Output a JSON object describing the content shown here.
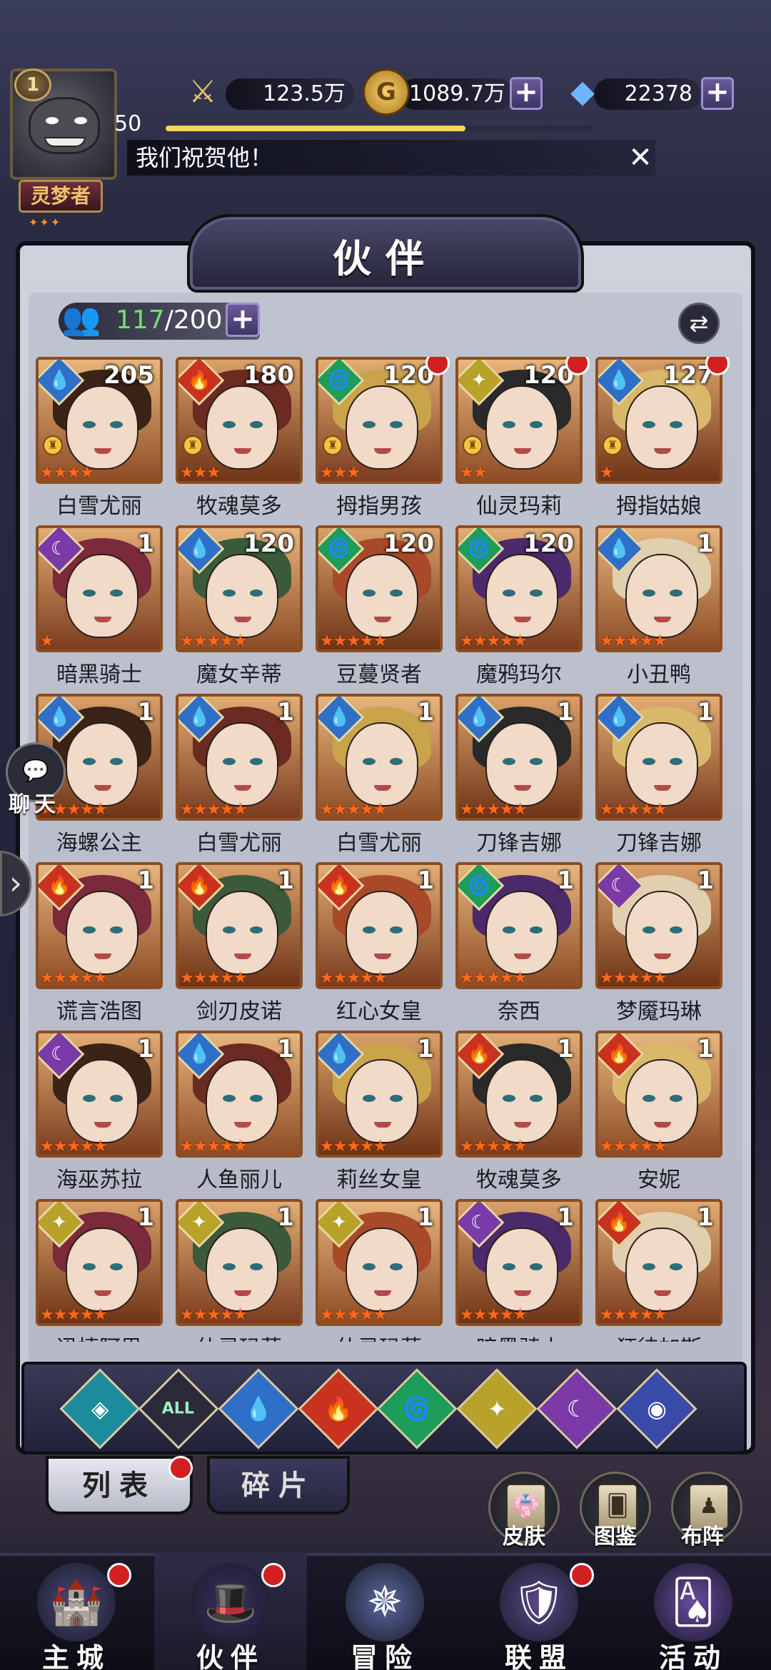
{
  "player": {
    "vip_level": "1",
    "level": "50",
    "title": "灵梦者",
    "xp_fraction": 0.7
  },
  "resources": {
    "power": "123.5万",
    "gold": "1089.7万",
    "diamond": "22378"
  },
  "notice": {
    "text": "我们祝贺他！"
  },
  "panel": {
    "title": "伙伴",
    "count_current": "117",
    "count_max": "/200"
  },
  "heroes": [
    {
      "name": "白雪尤丽",
      "level": "205",
      "element": "water",
      "stars": 4,
      "red_dot": false,
      "rank": true
    },
    {
      "name": "牧魂莫多",
      "level": "180",
      "element": "fire",
      "stars": 3,
      "red_dot": false,
      "rank": true
    },
    {
      "name": "拇指男孩",
      "level": "120",
      "element": "wind",
      "stars": 3,
      "red_dot": true,
      "rank": true
    },
    {
      "name": "仙灵玛莉",
      "level": "120",
      "element": "light",
      "stars": 2,
      "red_dot": true,
      "rank": true
    },
    {
      "name": "拇指姑娘",
      "level": "127",
      "element": "water",
      "stars": 1,
      "red_dot": true,
      "rank": true
    },
    {
      "name": "暗黑骑士",
      "level": "1",
      "element": "dark",
      "stars": 1,
      "red_dot": false,
      "rank": false
    },
    {
      "name": "魔女辛蒂",
      "level": "120",
      "element": "water",
      "stars": 5,
      "red_dot": false,
      "rank": false
    },
    {
      "name": "豆蔓贤者",
      "level": "120",
      "element": "wind",
      "stars": 5,
      "red_dot": false,
      "rank": false
    },
    {
      "name": "魔鸦玛尔",
      "level": "120",
      "element": "wind",
      "stars": 5,
      "red_dot": false,
      "rank": false
    },
    {
      "name": "小丑鸭",
      "level": "1",
      "element": "water",
      "stars": 5,
      "red_dot": false,
      "rank": false
    },
    {
      "name": "海螺公主",
      "level": "1",
      "element": "water",
      "stars": 5,
      "red_dot": false,
      "rank": false
    },
    {
      "name": "白雪尤丽",
      "level": "1",
      "element": "water",
      "stars": 5,
      "red_dot": false,
      "rank": false
    },
    {
      "name": "白雪尤丽",
      "level": "1",
      "element": "water",
      "stars": 5,
      "red_dot": false,
      "rank": false
    },
    {
      "name": "刀锋吉娜",
      "level": "1",
      "element": "water",
      "stars": 5,
      "red_dot": false,
      "rank": false
    },
    {
      "name": "刀锋吉娜",
      "level": "1",
      "element": "water",
      "stars": 5,
      "red_dot": false,
      "rank": false
    },
    {
      "name": "谎言浩图",
      "level": "1",
      "element": "fire",
      "stars": 5,
      "red_dot": false,
      "rank": false
    },
    {
      "name": "剑刃皮诺",
      "level": "1",
      "element": "fire",
      "stars": 5,
      "red_dot": false,
      "rank": false
    },
    {
      "name": "红心女皇",
      "level": "1",
      "element": "fire",
      "stars": 5,
      "red_dot": false,
      "rank": false
    },
    {
      "name": "奈西",
      "level": "1",
      "element": "wind",
      "stars": 5,
      "red_dot": false,
      "rank": false
    },
    {
      "name": "梦魇玛琳",
      "level": "1",
      "element": "dark",
      "stars": 5,
      "red_dot": false,
      "rank": false
    },
    {
      "name": "海巫苏拉",
      "level": "1",
      "element": "dark",
      "stars": 5,
      "red_dot": false,
      "rank": false
    },
    {
      "name": "人鱼丽儿",
      "level": "1",
      "element": "water",
      "stars": 5,
      "red_dot": false,
      "rank": false
    },
    {
      "name": "莉丝女皇",
      "level": "1",
      "element": "water",
      "stars": 5,
      "red_dot": false,
      "rank": false
    },
    {
      "name": "牧魂莫多",
      "level": "1",
      "element": "fire",
      "stars": 5,
      "red_dot": false,
      "rank": false
    },
    {
      "name": "安妮",
      "level": "1",
      "element": "fire",
      "stars": 5,
      "red_dot": false,
      "rank": false
    },
    {
      "name": "迅捷阿思",
      "level": "1",
      "element": "light",
      "stars": 5,
      "red_dot": false,
      "rank": false
    },
    {
      "name": "仙灵玛莉",
      "level": "1",
      "element": "light",
      "stars": 5,
      "red_dot": false,
      "rank": false
    },
    {
      "name": "仙灵玛莉",
      "level": "1",
      "element": "light",
      "stars": 5,
      "red_dot": false,
      "rank": false
    },
    {
      "name": "暗黑骑士",
      "level": "1",
      "element": "dark",
      "stars": 5,
      "red_dot": false,
      "rank": false
    },
    {
      "name": "狂徒加斯",
      "level": "1",
      "element": "fire",
      "stars": 5,
      "red_dot": false,
      "rank": false
    }
  ],
  "filters": [
    "void",
    "ALL",
    "water",
    "fire",
    "wind",
    "light",
    "dark",
    "cosmic"
  ],
  "tabs": {
    "list": "列表",
    "fragments": "碎片"
  },
  "quick_buttons": {
    "skin": "皮肤",
    "codex": "图鉴",
    "formation": "布阵"
  },
  "chat": {
    "label": "聊天"
  },
  "nav": [
    {
      "label": "主城",
      "icon": "castle-icon",
      "red_dot": true,
      "active": false
    },
    {
      "label": "伙伴",
      "icon": "hat-icon",
      "red_dot": true,
      "active": true
    },
    {
      "label": "冒险",
      "icon": "compass-icon",
      "red_dot": false,
      "active": false
    },
    {
      "label": "联盟",
      "icon": "shield-icon",
      "red_dot": true,
      "active": false
    },
    {
      "label": "活动",
      "icon": "cards-icon",
      "red_dot": false,
      "active": false
    }
  ],
  "element_colors": {
    "water": "#2f6fc8",
    "fire": "#c8321e",
    "wind": "#1e9c5a",
    "light": "#b8a22a",
    "dark": "#7a3aa8",
    "void": "#1c8c9c",
    "cosmic": "#3a4aa8"
  }
}
